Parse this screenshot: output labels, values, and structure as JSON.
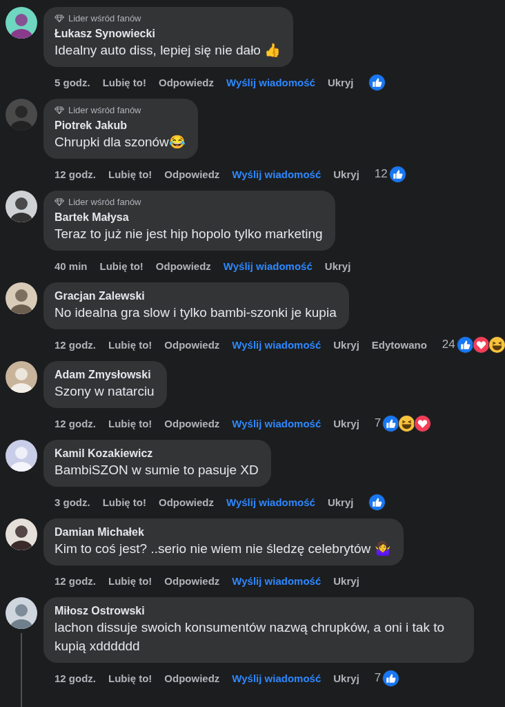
{
  "comments": [
    {
      "badge": "Lider wśród fanów",
      "author": "Łukasz Synowiecki",
      "text": "Idealny auto diss, lepiej się nie dało 👍",
      "time": "5 godz.",
      "like": "Lubię to!",
      "reply": "Odpowiedz",
      "message": "Wyślij wiadomość",
      "hide": "Ukryj",
      "reactions": [
        {
          "kind": "like"
        }
      ]
    },
    {
      "badge": "Lider wśród fanów",
      "author": "Piotrek Jakub",
      "text": "Chrupki dla szonów😂",
      "time": "12 godz.",
      "like": "Lubię to!",
      "reply": "Odpowiedz",
      "message": "Wyślij wiadomość",
      "hide": "Ukryj",
      "count": "12",
      "reactions": [
        {
          "kind": "like"
        }
      ]
    },
    {
      "badge": "Lider wśród fanów",
      "author": "Bartek Małysa",
      "text": "Teraz to już nie jest hip hopolo tylko marketing",
      "time": "40 min",
      "like": "Lubię to!",
      "reply": "Odpowiedz",
      "message": "Wyślij wiadomość",
      "hide": "Ukryj"
    },
    {
      "author": "Gracjan Zalewski",
      "text": "No idealna gra slow i tylko bambi-szonki je kupia",
      "time": "12 godz.",
      "like": "Lubię to!",
      "reply": "Odpowiedz",
      "message": "Wyślij wiadomość",
      "hide": "Ukryj",
      "edited": "Edytowano",
      "count": "24",
      "reactions": [
        {
          "kind": "like"
        },
        {
          "kind": "love"
        },
        {
          "kind": "haha"
        }
      ]
    },
    {
      "author": "Adam Zmysłowski",
      "text": "Szony w natarciu",
      "time": "12 godz.",
      "like": "Lubię to!",
      "reply": "Odpowiedz",
      "message": "Wyślij wiadomość",
      "hide": "Ukryj",
      "count": "7",
      "reactions": [
        {
          "kind": "like"
        },
        {
          "kind": "haha"
        },
        {
          "kind": "love"
        }
      ]
    },
    {
      "author": "Kamil Kozakiewicz",
      "text": "BambiSZON w sumie to pasuje XD",
      "time": "3 godz.",
      "like": "Lubię to!",
      "reply": "Odpowiedz",
      "message": "Wyślij wiadomość",
      "hide": "Ukryj",
      "reactions": [
        {
          "kind": "like"
        }
      ]
    },
    {
      "author": "Damian Michałek",
      "text": "Kim to coś jest? ..serio nie wiem nie śledzę celebrytów 🤷‍♀️",
      "time": "12 godz.",
      "like": "Lubię to!",
      "reply": "Odpowiedz",
      "message": "Wyślij wiadomość",
      "hide": "Ukryj"
    },
    {
      "author": "Miłosz Ostrowski",
      "text": "lachon dissuje swoich konsumentów nazwą chrupków, a oni i tak to kupią xdddddd",
      "time": "12 godz.",
      "like": "Lubię to!",
      "reply": "Odpowiedz",
      "message": "Wyślij wiadomość",
      "hide": "Ukryj",
      "count": "7",
      "has_replies": true,
      "reactions": [
        {
          "kind": "like"
        }
      ]
    }
  ]
}
